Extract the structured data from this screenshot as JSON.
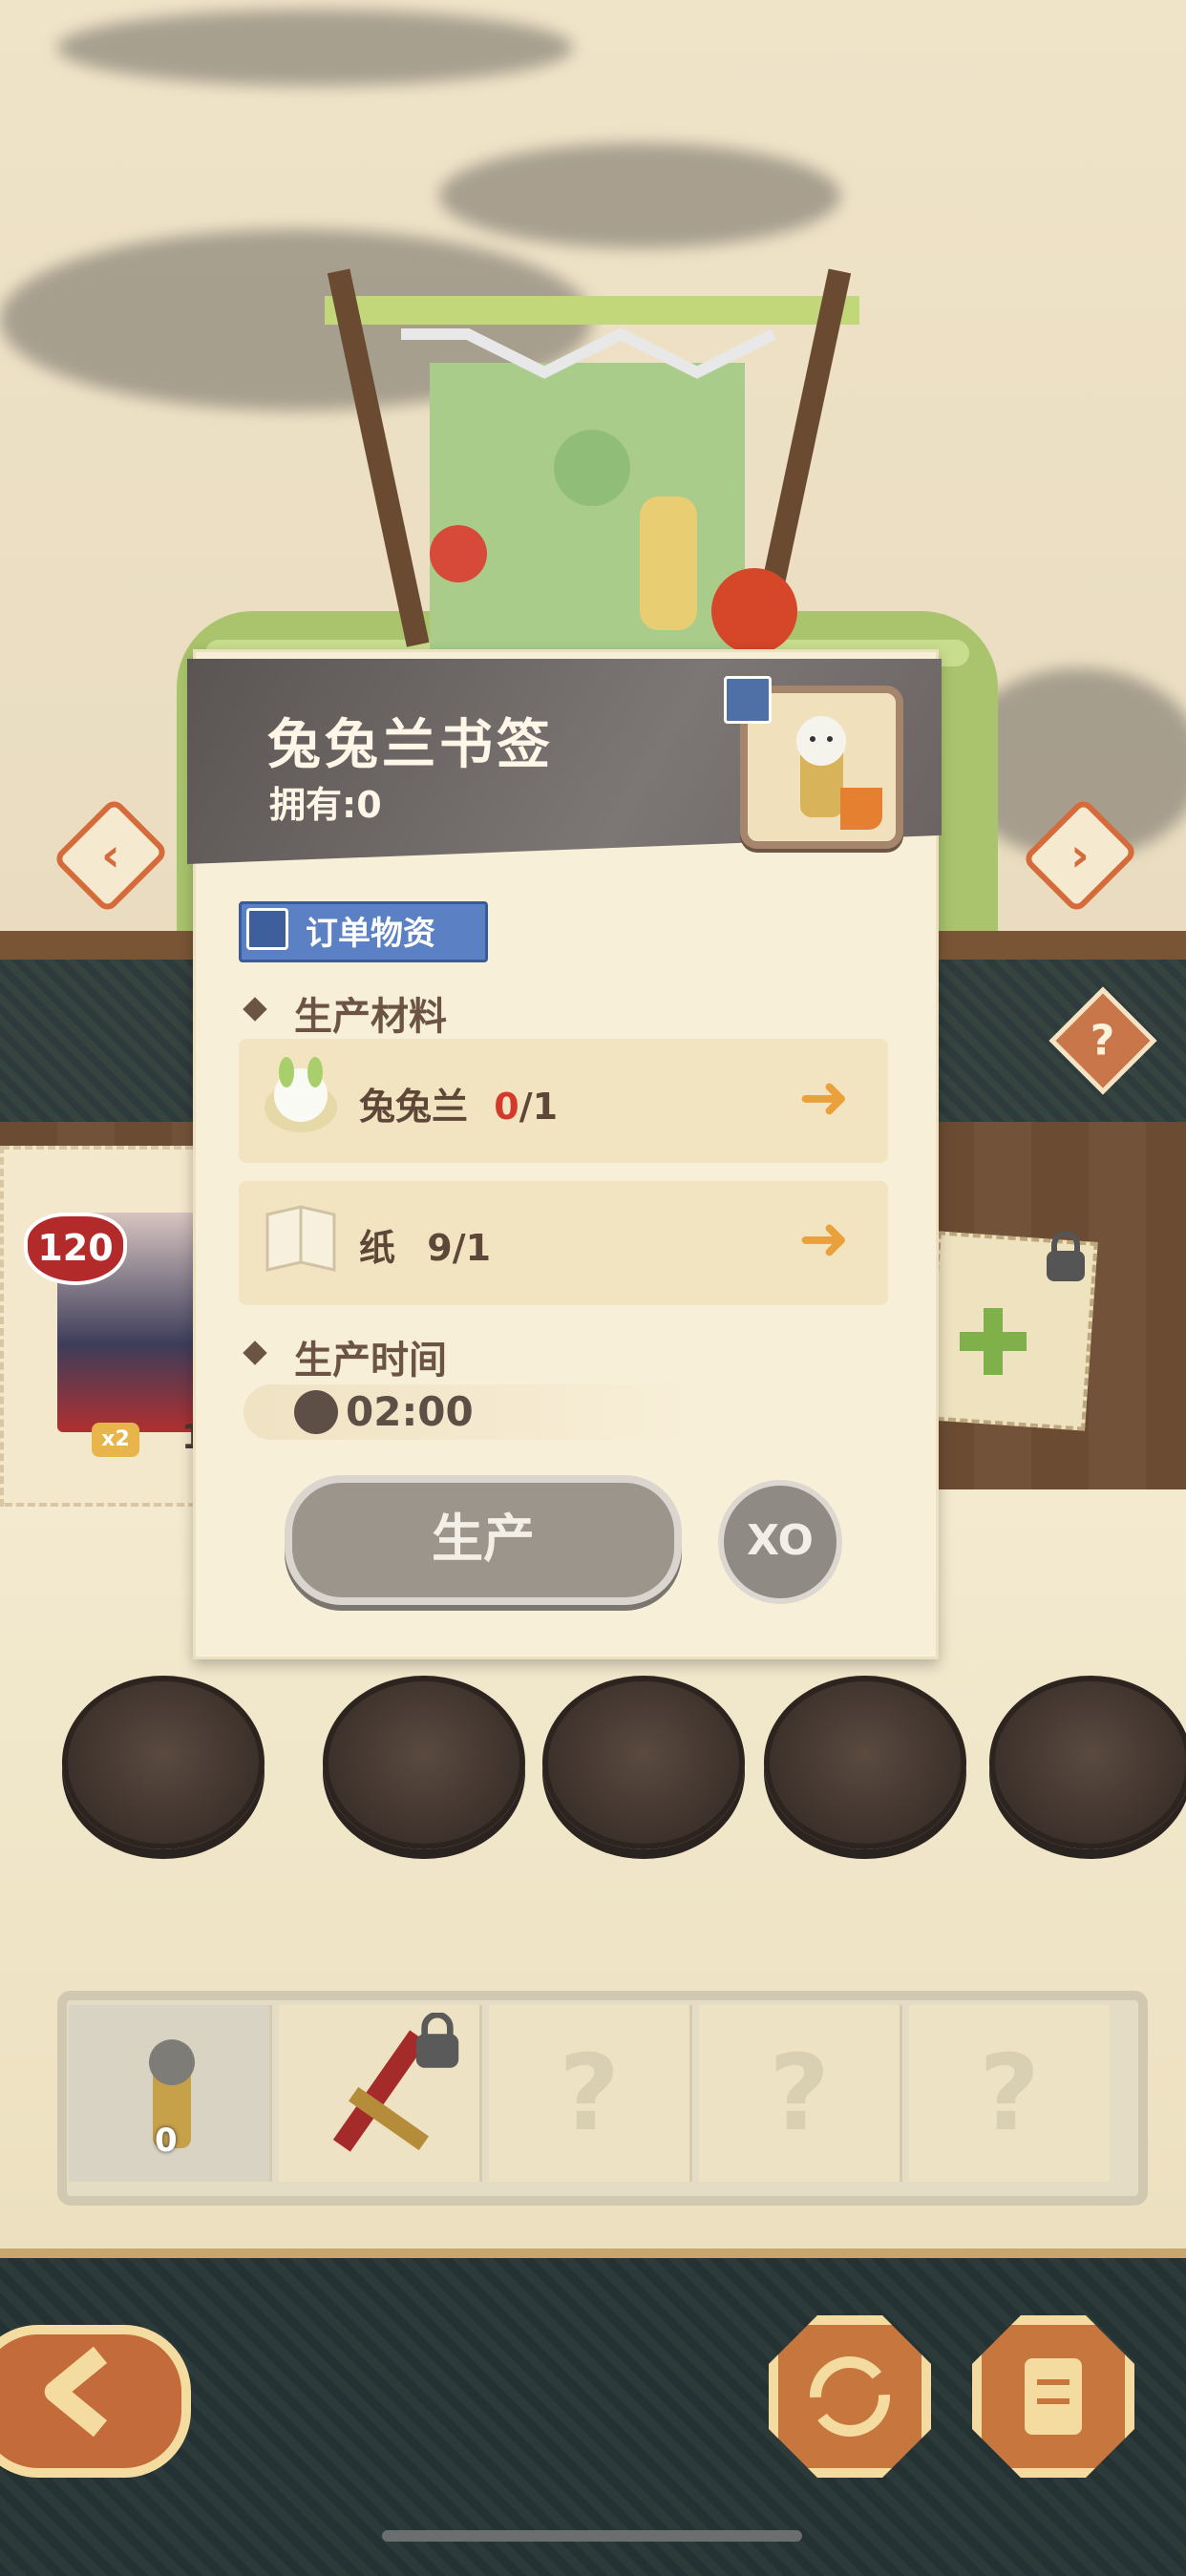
{
  "header": {
    "title": "兔兔兰书签",
    "owned_label": "拥有:0"
  },
  "order_tab": {
    "label": "订单物资"
  },
  "materials_section": {
    "label": "生产材料"
  },
  "materials": [
    {
      "name": "兔兔兰",
      "have": "0",
      "need": "/1",
      "icon": "bunny-flower-icon"
    },
    {
      "name": "纸",
      "have": "9",
      "need": "/1",
      "icon": "paper-icon"
    }
  ],
  "time_section": {
    "label": "生产时间",
    "duration": "02:00"
  },
  "actions": {
    "produce_label": "生产",
    "boost_label": "XO"
  },
  "left_card": {
    "level": "120",
    "multiplier": "x2",
    "count": "1"
  },
  "tray_slots": [
    {
      "state": "item",
      "count": "0",
      "icon": "bookmark-icon"
    },
    {
      "state": "locked",
      "icon": "hammer-icon"
    },
    {
      "state": "unknown",
      "label": "?"
    },
    {
      "state": "unknown",
      "label": "?"
    },
    {
      "state": "unknown",
      "label": "?"
    }
  ],
  "help_label": "?",
  "colors": {
    "accent_orange": "#d56b3b",
    "missing_red": "#d23a2c",
    "panel_cream": "#f8efd8",
    "header_gray": "#6c6664"
  }
}
